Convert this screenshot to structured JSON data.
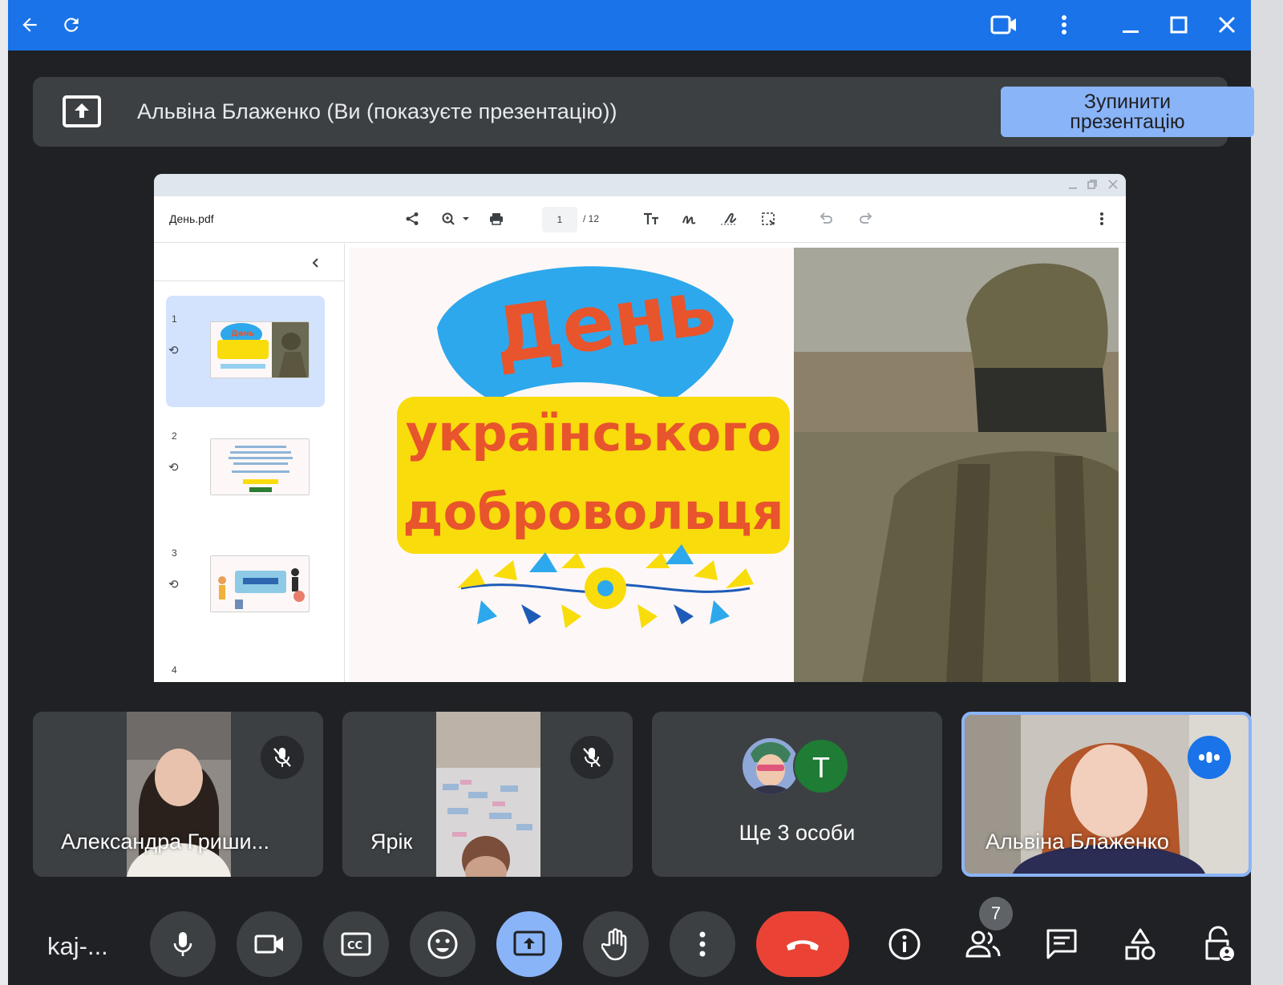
{
  "banner": {
    "text": "Альвіна Блаженко (Ви (показуєте презентацію))",
    "stop_line1": "Зупинити",
    "stop_line2": "презентацію"
  },
  "pdf": {
    "file_name": "День.pdf",
    "page_current": "1",
    "page_total": "/ 12",
    "thumbnails": [
      {
        "num": "1",
        "selected": true
      },
      {
        "num": "2",
        "selected": false
      },
      {
        "num": "3",
        "selected": false
      },
      {
        "num": "4",
        "selected": false
      }
    ]
  },
  "slide": {
    "line1": "День",
    "line2": "українського",
    "line3": "добровольця",
    "colors": {
      "blue": "#2ea8ec",
      "yellow": "#f9dc0c",
      "orange": "#e8542c"
    }
  },
  "participants": [
    {
      "name": "Александра Гриши...",
      "muted": true
    },
    {
      "name": "Ярік",
      "muted": true
    },
    {
      "name": "Ще 3 особи",
      "avatar_letter": "T"
    },
    {
      "name": "Альвіна Блаженко",
      "speaking": true
    }
  ],
  "controls": {
    "meeting_code": "kaj-...",
    "people_count": "7",
    "icons": [
      "mic-icon",
      "camera-icon",
      "captions-icon",
      "emoji-icon",
      "present-icon",
      "raise-hand-icon",
      "more-icon",
      "end-call-icon",
      "info-icon",
      "people-icon",
      "chat-icon",
      "activities-icon",
      "host-controls-icon"
    ]
  },
  "accent": "#1a73e8"
}
